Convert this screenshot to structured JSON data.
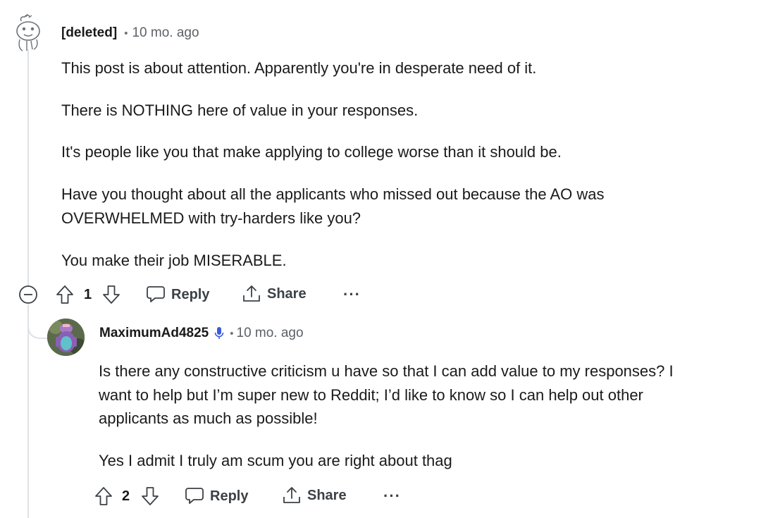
{
  "comment1": {
    "author": "[deleted]",
    "separator": "•",
    "time": "10 mo. ago",
    "paragraphs": [
      "This post is about attention. Apparently you're in desperate need of it.",
      "There is NOTHING here of value in your responses.",
      "It's people like you that make applying to college worse than it should be.",
      "Have you thought about all the applicants who missed out because the AO was",
      "OVERWHELMED with try-harders like you?",
      "You make their job MISERABLE."
    ],
    "score": "1",
    "reply_label": "Reply",
    "share_label": "Share",
    "more_label": "···"
  },
  "comment2": {
    "author": "MaximumAd4825",
    "separator": "•",
    "time": "10 mo. ago",
    "lines": [
      "Is there any constructive criticism u have so that I can add value to my responses? I",
      "want to help but I’m super new to Reddit; I’d like to know so I can help out other",
      "applicants as much as possible!",
      "Yes I admit I truly am scum you are right about thag"
    ],
    "score": "2",
    "reply_label": "Reply",
    "share_label": "Share",
    "more_label": "···"
  },
  "colors": {
    "text": "#1a1a1b",
    "meta": "#5c6166",
    "thread_line": "#dfe2e5",
    "mic_blue": "#3b5bdb"
  }
}
